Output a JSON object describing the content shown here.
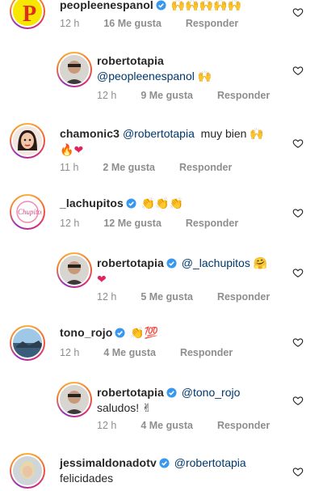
{
  "comments": [
    {
      "username": "peopleenespanol",
      "emoji": "🙌🙌🙌🙌🙌",
      "time": "12 h",
      "likes": "16 Me gusta",
      "reply": "Responder"
    },
    {
      "username": "robertotapia",
      "mention": "@peopleenespanol",
      "emoji": "🙌",
      "time": "12 h",
      "likes": "9 Me gusta",
      "reply": "Responder"
    },
    {
      "username": "chamonic3",
      "mention": "@robertotapia",
      "text": "muy bien",
      "emoji": "🙌",
      "emoji_line2": "🔥",
      "heart": "❤",
      "time": "11 h",
      "likes": "2 Me gusta",
      "reply": "Responder"
    },
    {
      "username": "_lachupitos",
      "emoji": "👏👏👏",
      "time": "12 h",
      "likes": "12 Me gusta",
      "reply": "Responder"
    },
    {
      "username": "robertotapia",
      "mention": "@_lachupitos",
      "emoji": "🤗",
      "heart": "❤",
      "time": "12 h",
      "likes": "5 Me gusta",
      "reply": "Responder"
    },
    {
      "username": "tono_rojo",
      "emoji": "👏💯",
      "time": "12 h",
      "likes": "4 Me gusta",
      "reply": "Responder"
    },
    {
      "username": "robertotapia",
      "mention": "@tono_rojo",
      "text": "saludos!",
      "emoji": "✌",
      "time": "12 h",
      "likes": "4 Me gusta",
      "reply": "Responder"
    },
    {
      "username": "jessimaldonadotv",
      "mention": "@robertotapia",
      "text": "felicidades"
    }
  ],
  "icons": {
    "heart": "heart-outline-icon",
    "verified": "verified-badge-icon"
  },
  "colors": {
    "mention": "#00376b",
    "verified": "#3897f0",
    "meta": "#8e8e8e"
  }
}
